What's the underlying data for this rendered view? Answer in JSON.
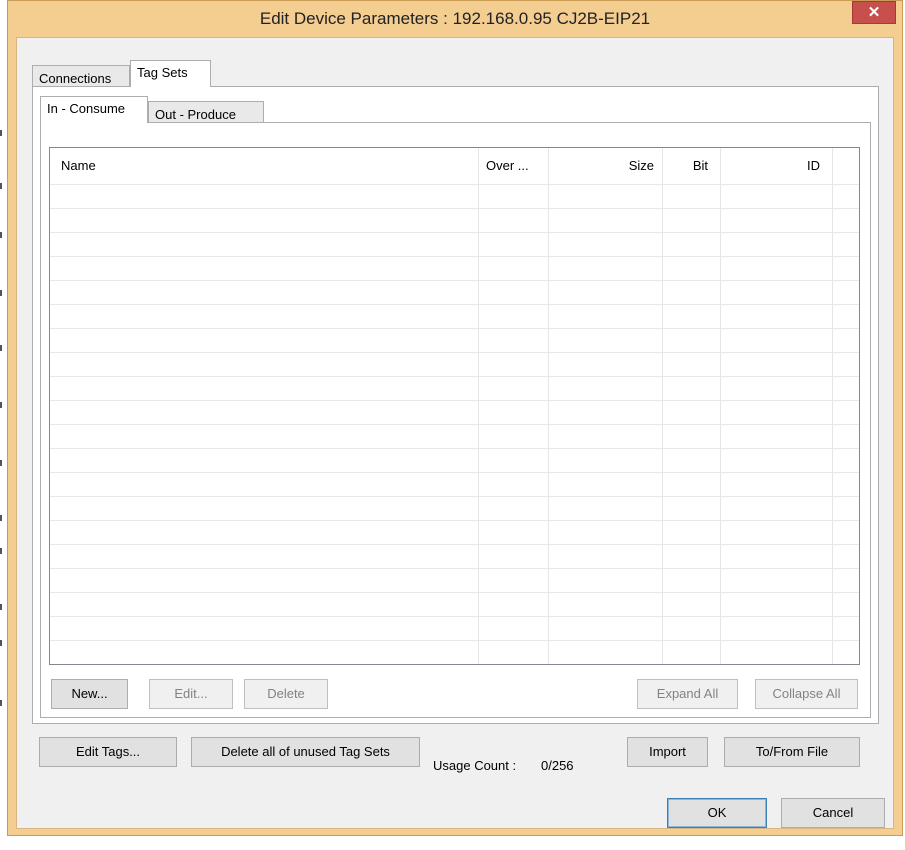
{
  "window": {
    "title": "Edit Device Parameters : 192.168.0.95 CJ2B-EIP21",
    "close_glyph": "✕"
  },
  "tabs": [
    {
      "label": "Connections",
      "active": false
    },
    {
      "label": "Tag Sets",
      "active": true
    }
  ],
  "subtabs": [
    {
      "label": "In - Consume",
      "active": true
    },
    {
      "label": "Out - Produce",
      "active": false
    }
  ],
  "table": {
    "columns": [
      "Name",
      "Over ...",
      "Size",
      "Bit",
      "ID"
    ],
    "rows": []
  },
  "panel_buttons": {
    "new": "New...",
    "edit": "Edit...",
    "delete": "Delete",
    "expand_all": "Expand All",
    "collapse_all": "Collapse All"
  },
  "bottom": {
    "edit_tags": "Edit Tags...",
    "delete_unused": "Delete all of unused Tag Sets",
    "usage_label": "Usage Count :",
    "usage_value": "0/256",
    "import": "Import",
    "to_from_file": "To/From File"
  },
  "dialog_buttons": {
    "ok": "OK",
    "cancel": "Cancel"
  },
  "colors": {
    "frame": "#f4cd91",
    "close": "#c7504d",
    "face": "#f0f0f0"
  }
}
